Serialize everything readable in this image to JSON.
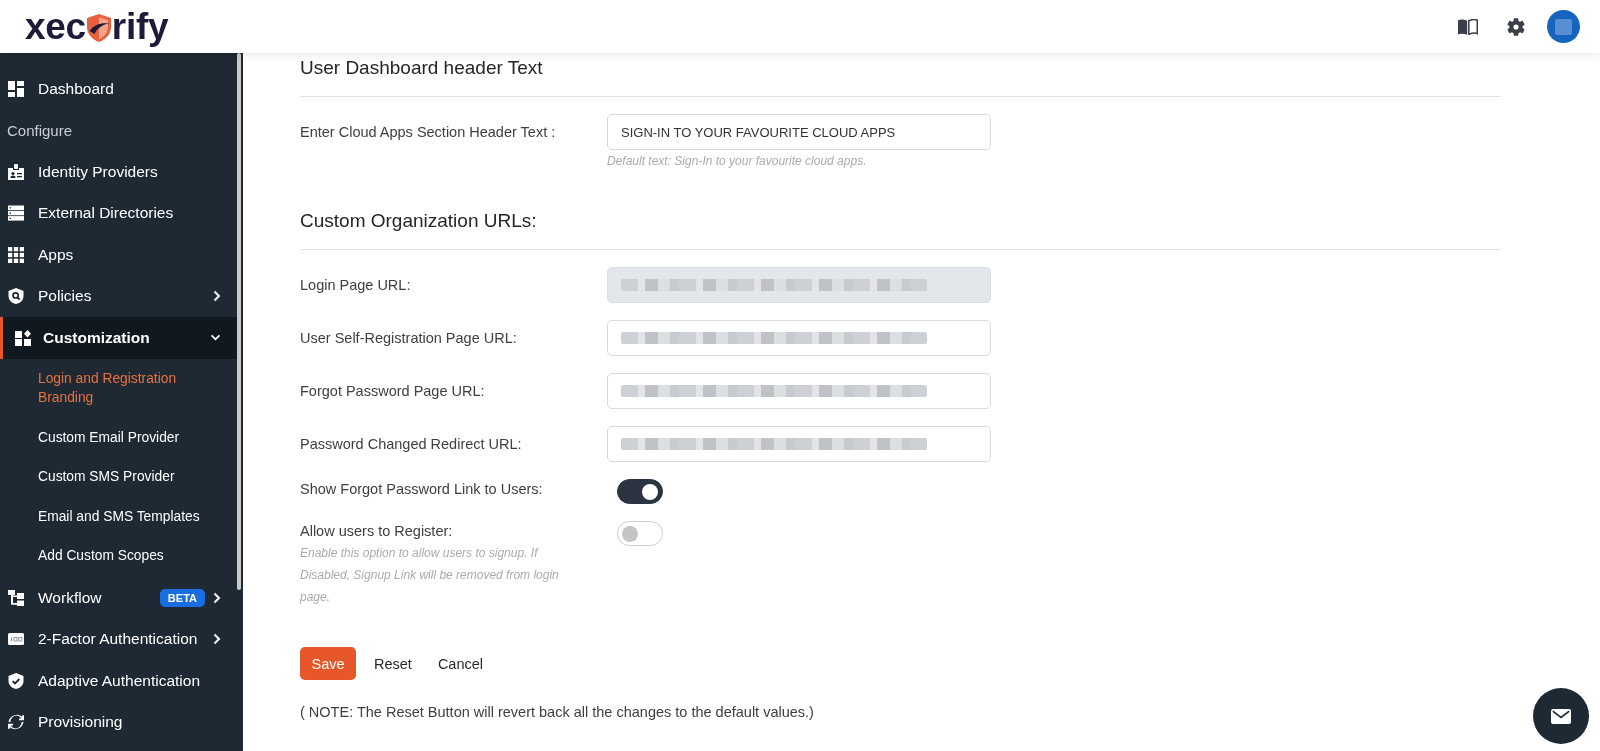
{
  "header": {
    "logo": [
      "xec",
      "rify"
    ]
  },
  "sidebar": {
    "items": [
      {
        "kind": "link",
        "label": "Dashboard",
        "selected": false
      },
      {
        "kind": "heading",
        "label": "Configure"
      },
      {
        "kind": "link",
        "label": "Identity Providers",
        "selected": false
      },
      {
        "kind": "link",
        "label": "External Directories",
        "selected": false
      },
      {
        "kind": "link",
        "label": "Apps",
        "selected": false
      },
      {
        "kind": "link",
        "label": "Policies",
        "selected": false,
        "expanded": false
      },
      {
        "kind": "link",
        "label": "Customization",
        "selected": true,
        "expanded": true,
        "children": [
          {
            "label": "Login and Registration Branding",
            "selected": true
          },
          {
            "label": "Custom Email Provider",
            "selected": false
          },
          {
            "label": "Custom SMS Provider",
            "selected": false
          },
          {
            "label": "Email and SMS Templates",
            "selected": false
          },
          {
            "label": "Add Custom Scopes",
            "selected": false
          }
        ]
      },
      {
        "kind": "link",
        "label": "Workflow",
        "selected": false,
        "expanded": false,
        "badge": "BETA"
      },
      {
        "kind": "link",
        "label": "2-Factor Authentication",
        "selected": false,
        "expanded": false
      },
      {
        "kind": "link",
        "label": "Adaptive Authentication",
        "selected": false
      },
      {
        "kind": "link",
        "label": "Provisioning",
        "selected": false
      }
    ]
  },
  "sections": [
    {
      "title": "User Dashboard header Text",
      "fields": [
        {
          "kind": "text",
          "label": "Enter Cloud Apps Section Header Text :",
          "value": "SIGN-IN TO YOUR FAVOURITE CLOUD APPS",
          "help": "Default text: Sign-In to your favourite cloud apps.",
          "disabled": false
        }
      ]
    },
    {
      "title": "Custom Organization URLs:",
      "fields": [
        {
          "kind": "text",
          "label": "Login Page URL:",
          "disabled": true,
          "value_redacted": true
        },
        {
          "kind": "text",
          "label": "User Self-Registration Page URL:",
          "disabled": false,
          "value_redacted": true
        },
        {
          "kind": "text",
          "label": "Forgot Password Page URL:",
          "disabled": false,
          "value_redacted": true
        },
        {
          "kind": "text",
          "label": "Password Changed Redirect URL:",
          "disabled": false,
          "value_redacted": true
        },
        {
          "kind": "toggle",
          "label": "Show Forgot Password Link to Users:",
          "on": true
        },
        {
          "kind": "toggle",
          "label": "Allow users to Register:",
          "on": false,
          "help": "Enable this option to allow users to signup. If Disabled, Signup Link will be removed from login page."
        }
      ]
    }
  ],
  "actions": [
    {
      "kind": "primary",
      "label": "Save"
    },
    {
      "kind": "plain",
      "label": "Reset"
    },
    {
      "kind": "plain",
      "label": "Cancel"
    }
  ],
  "note": "( NOTE: The Reset Button will revert back all the changes to the default values.)"
}
